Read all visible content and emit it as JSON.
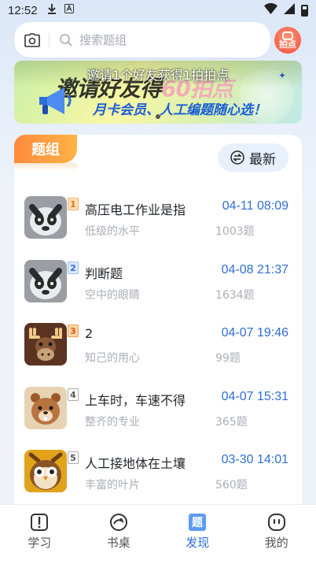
{
  "status_bar": {
    "time": "12:52"
  },
  "search": {
    "placeholder": "搜索题组",
    "paipai_label": "拍点"
  },
  "banner": {
    "notice": "邀请1个好友获得1拍拍点",
    "headline_prefix": "邀请好友得",
    "headline_accent": "60拍点",
    "subline": "月卡会员、人工编题随心选！"
  },
  "section": {
    "tab_label": "题组",
    "sort_label": "最新"
  },
  "groups": [
    {
      "rank": "1",
      "title": "高压电工作业是指",
      "subtitle": "低级的水平",
      "date": "04-11 08:09",
      "count": "1003题",
      "avatar": "panda"
    },
    {
      "rank": "2",
      "title": "判断题",
      "subtitle": "空中的眼睛",
      "date": "04-08 21:37",
      "count": "1634题",
      "avatar": "panda"
    },
    {
      "rank": "3",
      "title": "2",
      "subtitle": "知己的用心",
      "date": "04-07 19:46",
      "count": "99题",
      "avatar": "moose"
    },
    {
      "rank": "4",
      "title": "上车时，车速不得",
      "subtitle": "整齐的专业",
      "date": "04-07 15:31",
      "count": "365题",
      "avatar": "beaver"
    },
    {
      "rank": "5",
      "title": "人工接地体在土壤",
      "subtitle": "丰富的叶片",
      "date": "03-30 14:01",
      "count": "560题",
      "avatar": "owl"
    }
  ],
  "nav": [
    {
      "label": "学习",
      "icon": "alert-book-icon"
    },
    {
      "label": "书桌",
      "icon": "desk-icon"
    },
    {
      "label": "发现",
      "icon": "discover-icon",
      "active": true
    },
    {
      "label": "我的",
      "icon": "profile-face-icon"
    }
  ],
  "colors": {
    "accent": "#2f6fd6",
    "tab_orange": "#ff8a3d"
  }
}
